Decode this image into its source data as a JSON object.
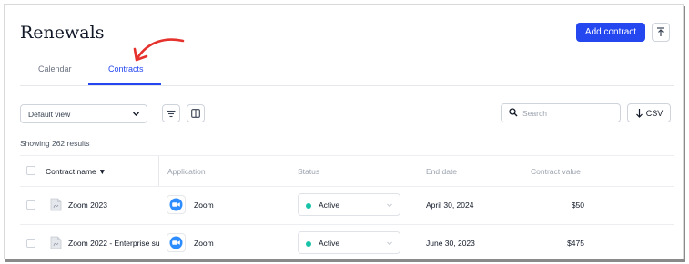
{
  "header": {
    "title": "Renewals",
    "add_contract_label": "Add contract"
  },
  "tabs": [
    {
      "label": "Calendar"
    },
    {
      "label": "Contracts"
    }
  ],
  "toolbar": {
    "view": "Default view",
    "search_placeholder": "Search",
    "csv_label": "CSV"
  },
  "results_text": "Showing 262 results",
  "table": {
    "columns": [
      {
        "label": "Contract name ▼"
      },
      {
        "label": "Application"
      },
      {
        "label": "Status"
      },
      {
        "label": "End date"
      },
      {
        "label": "Contract value"
      }
    ],
    "rows": [
      {
        "name": "Zoom 2023",
        "application": "Zoom",
        "status": "Active",
        "end_date": "April 30, 2024",
        "value": "$50"
      },
      {
        "name": "Zoom 2022 - Enterprise su",
        "application": "Zoom",
        "status": "Active",
        "end_date": "June 30, 2023",
        "value": "$475"
      }
    ]
  },
  "colors": {
    "accent": "#2547f0",
    "status_active": "#18c3a8",
    "zoom_brand": "#2d8cff",
    "annotation_arrow": "#e5322d"
  },
  "icons": [
    "export-icon",
    "chevron-down-icon",
    "filter-icon",
    "columns-icon",
    "search-icon",
    "download-icon",
    "document-icon",
    "zoom-logo-icon",
    "annotation-arrow"
  ]
}
